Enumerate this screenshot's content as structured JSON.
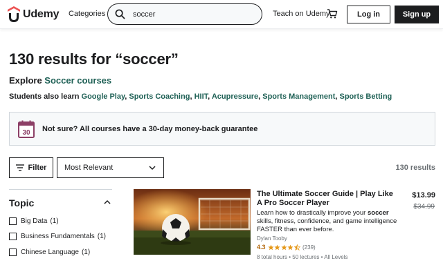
{
  "header": {
    "logo_text": "Udemy",
    "categories_label": "Categories",
    "search_value": "soccer",
    "teach_label": "Teach on Udemy",
    "login_label": "Log in",
    "signup_label": "Sign up"
  },
  "results": {
    "title": "130 results for “soccer”",
    "explore_prefix": "Explore ",
    "explore_link": "Soccer courses",
    "also_label": "Students also learn ",
    "also_links": [
      "Google Play",
      "Sports Coaching",
      "HIIT",
      "Acupressure",
      "Sports Management",
      "Sports Betting"
    ],
    "count_label": "130 results"
  },
  "banner": {
    "calendar_number": "30",
    "text": "Not sure? All courses have a 30-day money-back guarantee"
  },
  "filters": {
    "filter_label": "Filter",
    "sort_value": "Most Relevant"
  },
  "sidebar": {
    "topic_title": "Topic",
    "items": [
      {
        "label": "Big Data",
        "count": "(1)"
      },
      {
        "label": "Business Fundamentals",
        "count": "(1)"
      },
      {
        "label": "Chinese Language",
        "count": "(1)"
      }
    ]
  },
  "course": {
    "title": "The Ultimate Soccer Guide | Play Like A Pro Soccer Player",
    "desc_1": "Learn how to drastically improve your ",
    "desc_bold": "soccer",
    "desc_2": " skills, fitness, confidence, and game intelligence FASTER than ever before.",
    "author": "Dylan Tooby",
    "rating": "4.3",
    "rating_count": "(239)",
    "meta": "8 total hours • 50 lectures • All Levels",
    "price": "$13.99",
    "old_price": "$34.99"
  },
  "colors": {
    "brand": "#a435f0",
    "logo_red": "#ec5252",
    "link": "#1e6055",
    "rating": "#b4690e",
    "calendar": "#8c3f66"
  }
}
